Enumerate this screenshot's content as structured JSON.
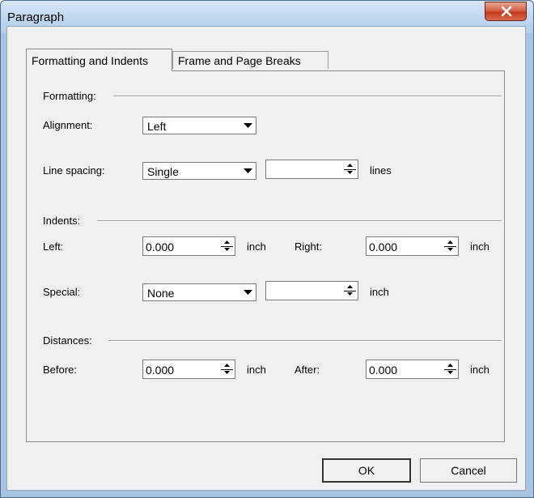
{
  "window": {
    "title": "Paragraph"
  },
  "tabs": [
    {
      "label": "Formatting and Indents",
      "active": true
    },
    {
      "label": "Frame and Page Breaks",
      "active": false
    }
  ],
  "formatting": {
    "group_label": "Formatting:",
    "alignment_label": "Alignment:",
    "alignment_value": "Left",
    "line_spacing_label": "Line spacing:",
    "line_spacing_value": "Single",
    "line_spacing_amount": "",
    "line_spacing_unit": "lines"
  },
  "indents": {
    "group_label": "Indents:",
    "left_label": "Left:",
    "left_value": "0.000",
    "left_unit": "inch",
    "right_label": "Right:",
    "right_value": "0.000",
    "right_unit": "inch",
    "special_label": "Special:",
    "special_value": "None",
    "special_amount": "",
    "special_unit": "inch"
  },
  "distances": {
    "group_label": "Distances:",
    "before_label": "Before:",
    "before_value": "0.000",
    "before_unit": "inch",
    "after_label": "After:",
    "after_value": "0.000",
    "after_unit": "inch"
  },
  "buttons": {
    "ok_label": "OK",
    "cancel_label": "Cancel"
  },
  "icons": {
    "close": "close-icon",
    "dropdown": "chevron-down-icon",
    "spin_up": "spin-up-icon",
    "spin_down": "spin-down-icon"
  },
  "colors": {
    "titlebar": "#c3d9f0",
    "close_button": "#c23a1d",
    "dialog_bg": "#f0f0f0"
  }
}
